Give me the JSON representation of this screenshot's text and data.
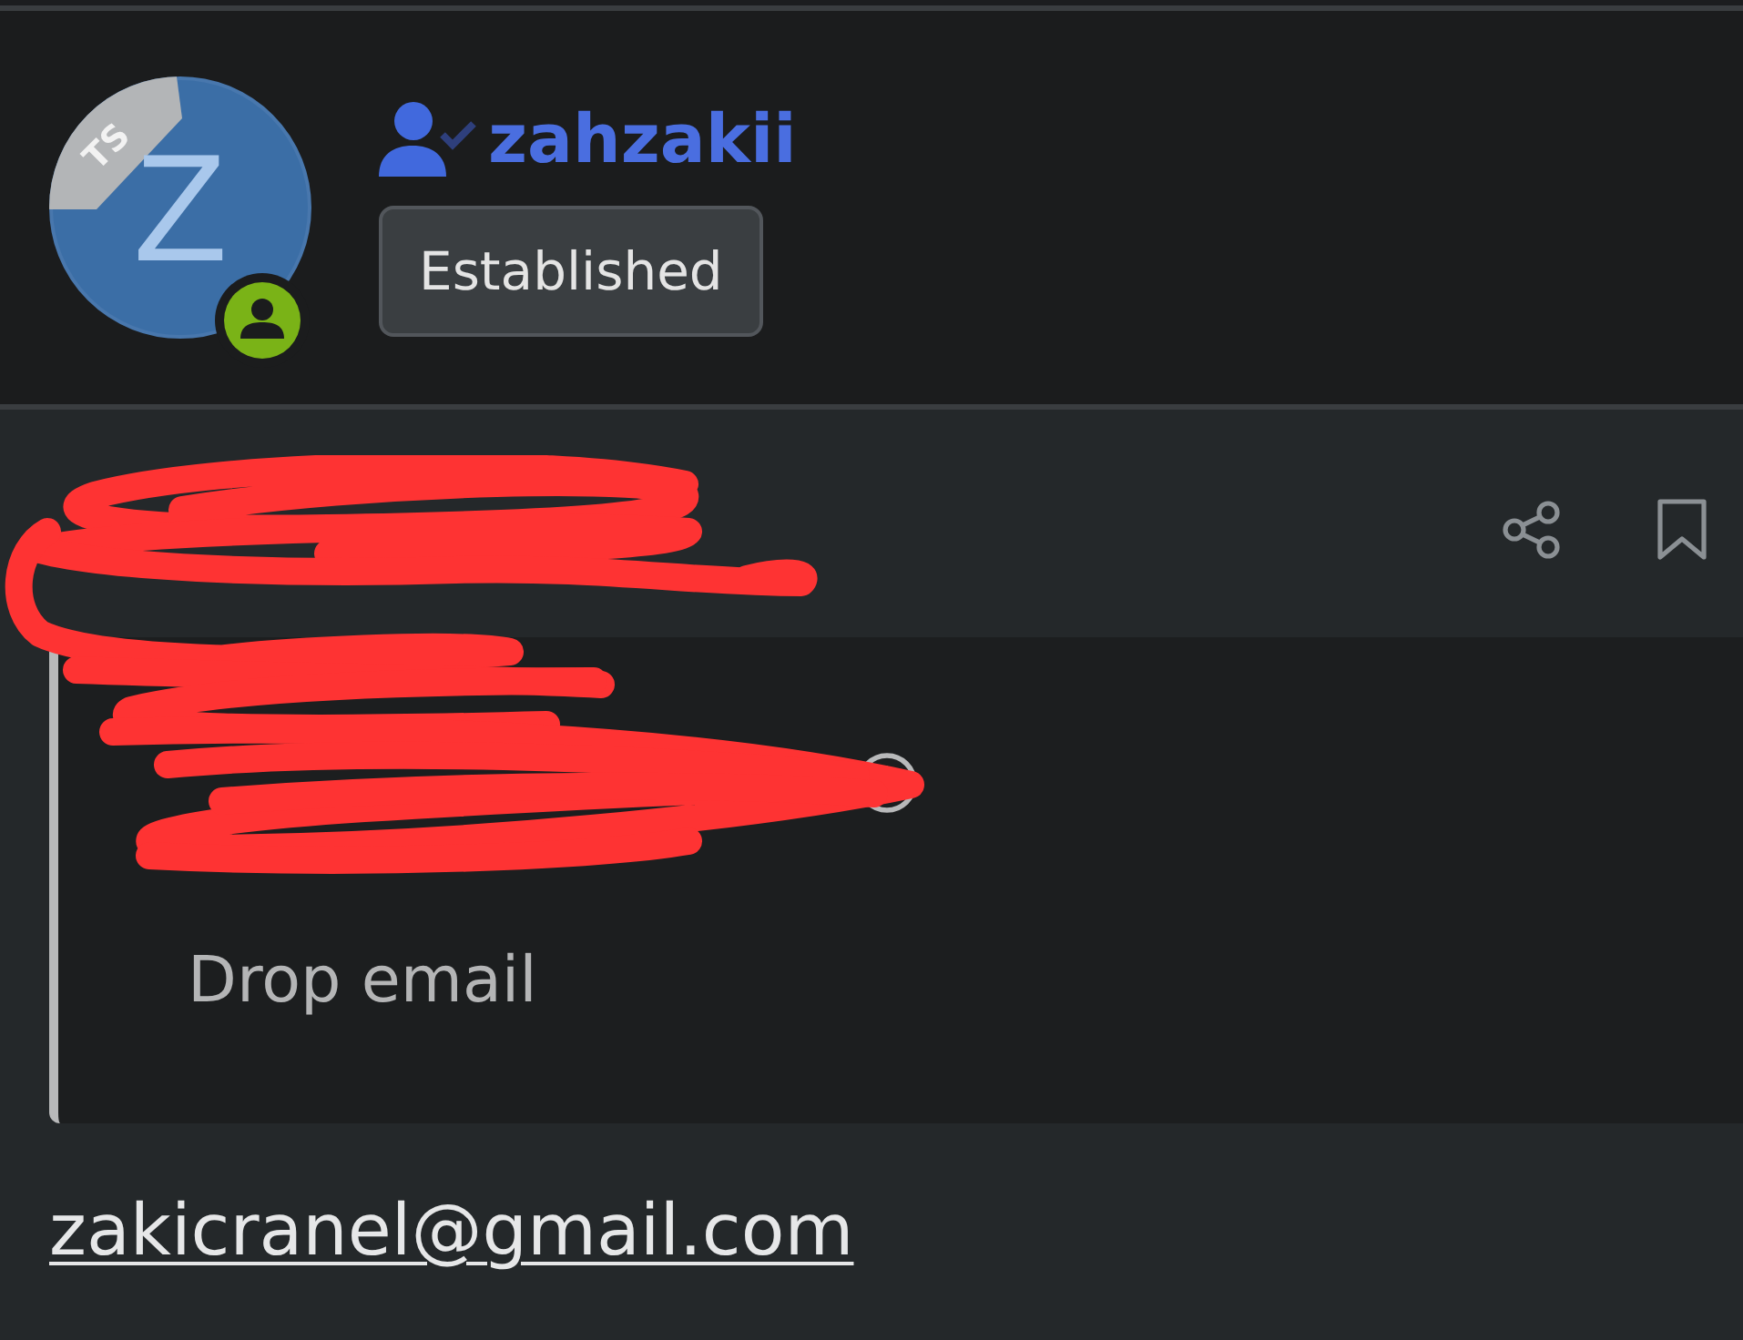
{
  "member": {
    "avatar": {
      "letter": "Z",
      "ribbon": "TS"
    },
    "online": true,
    "verified": true,
    "username": "zahzakii",
    "user_title": "Established"
  },
  "post": {
    "actions": [
      {
        "kind": "share"
      },
      {
        "kind": "bookmark"
      }
    ],
    "quote": {
      "has_source_link": true,
      "text": "Drop email"
    },
    "body": {
      "link": "zakicranel@gmail.com"
    }
  }
}
